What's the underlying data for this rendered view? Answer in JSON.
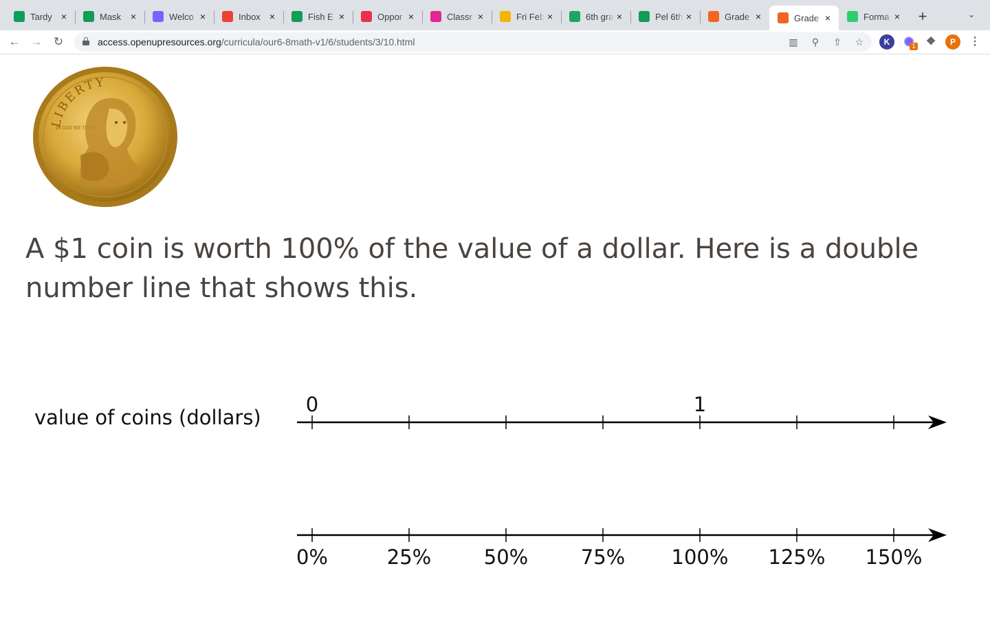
{
  "browser": {
    "tabs": [
      {
        "label": "Tardy",
        "icon": "google-sheets-icon",
        "color": "#0f9d58"
      },
      {
        "label": "Mask",
        "icon": "google-sheets-icon",
        "color": "#0f9d58"
      },
      {
        "label": "Welco",
        "icon": "colorful-swirl-icon",
        "color": "#7b61ff"
      },
      {
        "label": "Inbox",
        "icon": "gmail-icon",
        "color": "#ea4335"
      },
      {
        "label": "Fish E",
        "icon": "google-sheets-icon",
        "color": "#0f9d58"
      },
      {
        "label": "Oppor",
        "icon": "pulse-heart-icon",
        "color": "#e8314f"
      },
      {
        "label": "Classr",
        "icon": "classroom-icon",
        "color": "#e52592"
      },
      {
        "label": "Fri Feb",
        "icon": "google-slides-icon",
        "color": "#f4b400"
      },
      {
        "label": "6th gra",
        "icon": "google-drive-icon",
        "color": "#1fa463"
      },
      {
        "label": "Pel 6th",
        "icon": "google-sheets-icon",
        "color": "#0f9d58"
      },
      {
        "label": "Grade",
        "icon": "openup-icon",
        "color": "#f26522"
      },
      {
        "label": "Grade",
        "icon": "openup-icon",
        "color": "#f26522",
        "active": true
      },
      {
        "label": "Forma",
        "icon": "formative-icon",
        "color": "#2ecc71"
      }
    ],
    "url_domain": "access.openupresources.org",
    "url_path": "/curricula/our6-8math-v1/6/students/3/10.html",
    "profile_initial": "P",
    "ext_badge": "1",
    "ext_k": "K"
  },
  "page": {
    "intro": "A $1 coin is worth 100% of the value of a dollar. Here is a double number line that shows this.",
    "coin_alt": "Sacagawea dollar coin",
    "coin_text_top": "LIBERTY",
    "coin_text_motto": "IN GOD WE TRUST",
    "number_line": {
      "top_label": "value of coins (dollars)",
      "top_ticks": [
        "0",
        "",
        "",
        "",
        "1",
        "",
        ""
      ],
      "bottom_ticks": [
        "0%",
        "25%",
        "50%",
        "75%",
        "100%",
        "125%",
        "150%"
      ]
    }
  },
  "colors": {
    "text": "#4a4440",
    "coin_gold": "#d9a93a",
    "tab_strip": "#dee1e6"
  }
}
